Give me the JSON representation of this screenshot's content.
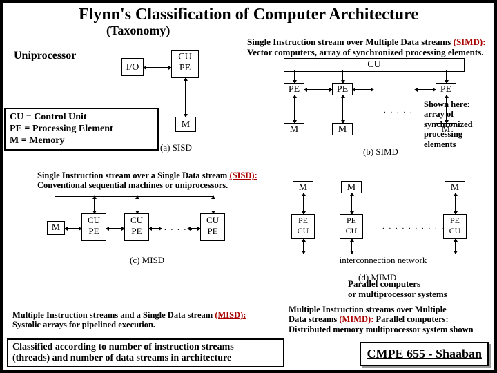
{
  "title": "Flynn's Classification of Computer Architecture",
  "subtitle": "(Taxonomy)",
  "uniprocessor": "Uniprocessor",
  "simd_desc": {
    "line1_pre": "Single Instruction stream over Multiple Data streams ",
    "line1_u": "(SIMD):",
    "line2": "Vector computers, array of synchronized processing elements."
  },
  "key": {
    "l1": "CU = Control Unit",
    "l2": "PE = Processing Element",
    "l3": "M = Memory"
  },
  "shown": {
    "l1": "Shown here:",
    "l2": "array of synchronized",
    "l3": "processing elements"
  },
  "sisd_desc": {
    "line1_pre": "Single Instruction stream over a Single Data stream ",
    "line1_u": "(SISD):",
    "line2": "Conventional sequential machines or uniprocessors."
  },
  "misd_desc": {
    "line1_pre": "Multiple Instruction streams and a Single Data stream ",
    "line1_u": "(MISD):",
    "line2": "Systolic arrays for pipelined execution."
  },
  "parallel": {
    "l1": "Parallel computers",
    "l2": "or multiprocessor systems"
  },
  "mimd_desc": {
    "l1": "Multiple Instruction streams over Multiple",
    "l2_pre": "Data streams ",
    "l2_u": "(MIMD):",
    "l2_post": "  Parallel computers:",
    "l3": "Distributed memory multiprocessor system shown"
  },
  "classified": {
    "l1": "Classified according to number of instruction streams",
    "l2": "(threads) and number of data streams in architecture"
  },
  "course": "CMPE 655  -  Shaaban",
  "labels": {
    "io": "I/O",
    "cu": "CU",
    "pe": "PE",
    "m": "M",
    "interconnect": "interconnection network"
  },
  "captions": {
    "sisd": "(a) SISD",
    "simd": "(b) SIMD",
    "misd": "(c) MISD",
    "mimd": "(d) MIMD"
  }
}
